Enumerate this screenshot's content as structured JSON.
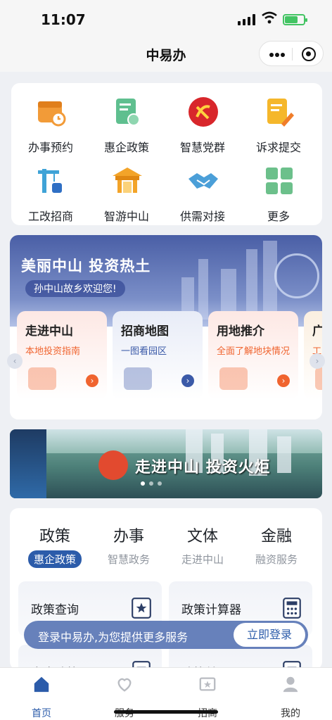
{
  "status": {
    "time": "11:07",
    "battery_level": 0.7
  },
  "nav": {
    "title": "中易办"
  },
  "services": [
    {
      "label": "办事预约",
      "icon": "calendar-clock-icon",
      "color": "#f29b38"
    },
    {
      "label": "惠企政策",
      "icon": "certificate-icon",
      "color": "#5fbf8f"
    },
    {
      "label": "智慧党群",
      "icon": "party-emblem-icon",
      "color": "#d8262b"
    },
    {
      "label": "诉求提交",
      "icon": "document-edit-icon",
      "color": "#f5b72b"
    },
    {
      "label": "工改招商",
      "icon": "crane-icon",
      "color": "#3fa3d7"
    },
    {
      "label": "智游中山",
      "icon": "pavilion-icon",
      "color": "#f3a429"
    },
    {
      "label": "供需对接",
      "icon": "handshake-icon",
      "color": "#4b9fd8"
    },
    {
      "label": "更多",
      "icon": "grid-more-icon",
      "color": "#6cc08b"
    }
  ],
  "invest": {
    "headline": "美丽中山  投资热土",
    "subline": "孙中山故乡欢迎您!",
    "cards": [
      {
        "title": "走进中山",
        "subtitle": "本地投资指南",
        "accent": "#f0642f",
        "bg": "#fde8e4"
      },
      {
        "title": "招商地图",
        "subtitle": "一图看园区",
        "accent": "#3b5aa8",
        "bg": "#e8ecf7"
      },
      {
        "title": "用地推介",
        "subtitle": "全面了解地块情况",
        "accent": "#f0642f",
        "bg": "#fde8e4"
      },
      {
        "title": "广",
        "subtitle": "工",
        "accent": "#f0642f",
        "bg": "#fbefe0"
      }
    ]
  },
  "photo_banner": {
    "slogan": "走进中山 投资火炬"
  },
  "tabs": [
    {
      "title": "政策",
      "subtitle": "惠企政策",
      "active": true
    },
    {
      "title": "办事",
      "subtitle": "智慧政务",
      "active": false
    },
    {
      "title": "文体",
      "subtitle": "走进中山",
      "active": false
    },
    {
      "title": "金融",
      "subtitle": "融资服务",
      "active": false
    }
  ],
  "policy_items": [
    {
      "label": "政策查询",
      "icon": "policy-book-icon"
    },
    {
      "label": "政策计算器",
      "icon": "calculator-icon"
    },
    {
      "label": "惠企政策",
      "icon": "policy-doc-icon"
    },
    {
      "label": "政策兑现",
      "icon": "policy-doc-icon"
    }
  ],
  "login_prompt": {
    "message": "登录中易办,为您提供更多服务",
    "button": "立即登录"
  },
  "tabbar": [
    {
      "label": "首页",
      "icon": "home-icon",
      "active": true
    },
    {
      "label": "服务",
      "icon": "service-heart-icon",
      "active": false
    },
    {
      "label": "招商",
      "icon": "investment-icon",
      "active": false
    },
    {
      "label": "我的",
      "icon": "user-icon",
      "active": false
    }
  ],
  "colors": {
    "primary": "#2c5caa",
    "banner": "#5a6fb4",
    "background": "#eef0f4"
  }
}
